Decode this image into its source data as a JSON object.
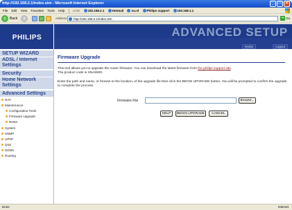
{
  "window": {
    "title": "http://192.168.2.1/index.stm - Microsoft Internet Explorer"
  },
  "menu": [
    "File",
    "Edit",
    "View",
    "Favorites",
    "Tools",
    "Help"
  ],
  "links_bar": {
    "label": "Links",
    "links": [
      "192.168.2.1",
      "Hotmail",
      "nu.nl",
      "Philips support",
      "192.168.1.1"
    ]
  },
  "toolbar": {
    "back_label": "Back",
    "address_label": "Address",
    "address_value": "http://192.168.2.1/index.stm",
    "go_label": "Go"
  },
  "header": {
    "logo": "PHILIPS",
    "title": "ADVANCED SETUP",
    "home": "Home",
    "logout": "Logout"
  },
  "sidebar": {
    "sections": [
      "SETUP WIZARD",
      "ADSL / Internet Settings",
      "Security",
      "Home Network Settings",
      "Advanced Settings"
    ],
    "items": [
      "NAT",
      "Maintenance",
      "Configuration Tools",
      "Firmware Upgrade",
      "Reset",
      "System",
      "SNMP",
      "UPnP",
      "QoS",
      "DDNS",
      "Routing"
    ]
  },
  "content": {
    "heading": "Firmware Upgrade",
    "para1_a": "This tool allows you to upgrade the router firmware. You can download the latest firmware from ",
    "para1_link": "the philips support site",
    "para1_b": ".",
    "para1_line2": "The product code is SNA6500.",
    "para2": "Enter the path and name, or browse to the location, of the upgrade file then click the BEGIN UPGRADE button. You will be prompted to confirm the upgrade to complete the process.",
    "file_label": "Firmware File",
    "file_value": "",
    "browse": "Browse...",
    "help": "HELP",
    "begin": "BEGIN UPGRADE",
    "cancel": "CANCEL"
  },
  "status": {
    "left": "Done",
    "right": "Internet"
  }
}
